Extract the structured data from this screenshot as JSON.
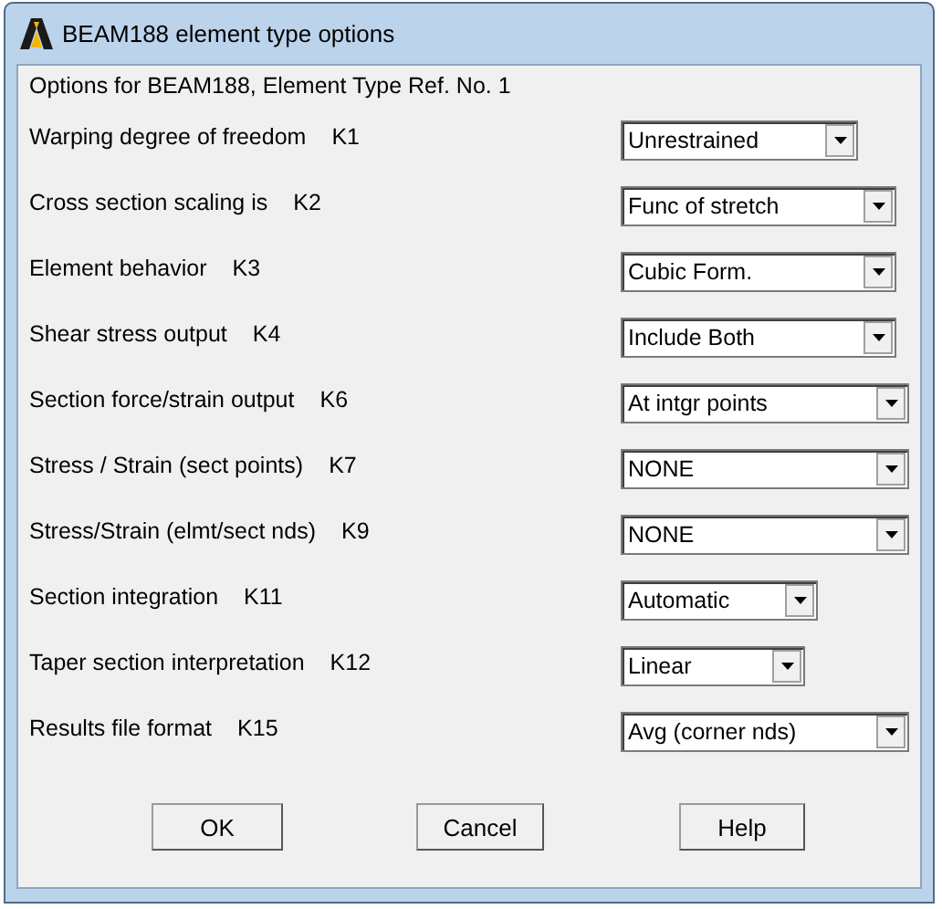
{
  "window": {
    "title": "BEAM188 element type options"
  },
  "heading": "Options for BEAM188, Element Type Ref. No. 1",
  "options": [
    {
      "label": "Warping degree of freedom",
      "key": "K1",
      "value": "Unrestrained"
    },
    {
      "label": "Cross section scaling is",
      "key": "K2",
      "value": "Func of stretch"
    },
    {
      "label": "Element behavior",
      "key": "K3",
      "value": "Cubic Form."
    },
    {
      "label": "Shear stress output",
      "key": "K4",
      "value": "Include Both"
    },
    {
      "label": "Section force/strain output",
      "key": "K6",
      "value": "At intgr points"
    },
    {
      "label": "Stress / Strain (sect points)",
      "key": "K7",
      "value": "NONE"
    },
    {
      "label": "Stress/Strain (elmt/sect nds)",
      "key": "K9",
      "value": "NONE"
    },
    {
      "label": "Section integration",
      "key": "K11",
      "value": "Automatic"
    },
    {
      "label": "Taper section interpretation",
      "key": "K12",
      "value": "Linear"
    },
    {
      "label": "Results file format",
      "key": "K15",
      "value": "Avg (corner nds)"
    }
  ],
  "buttons": [
    "OK",
    "Cancel",
    "Help"
  ]
}
